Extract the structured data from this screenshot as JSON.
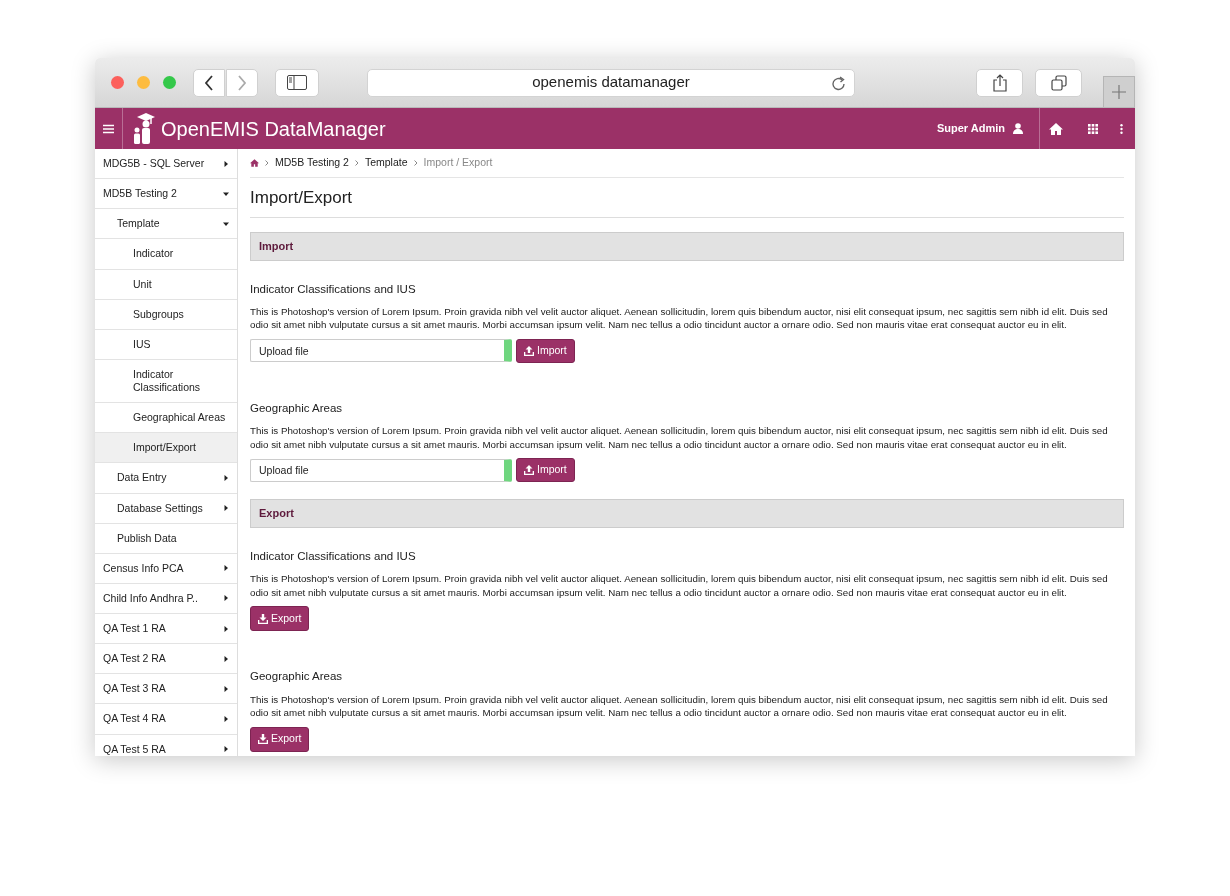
{
  "browser": {
    "address": "openemis datamanager"
  },
  "app": {
    "title": "OpenEMIS DataManager",
    "user": "Super Admin"
  },
  "sidebar": {
    "items": [
      {
        "label": "MDG5B - SQL Server",
        "expanded": false,
        "selected": false
      },
      {
        "label": "MD5B Testing 2",
        "expanded": true,
        "selected": false,
        "children": [
          {
            "label": "Template",
            "expanded": true,
            "selected": false,
            "children": [
              {
                "label": "Indicator",
                "selected": false
              },
              {
                "label": "Unit",
                "selected": false
              },
              {
                "label": "Subgroups",
                "selected": false
              },
              {
                "label": "IUS",
                "selected": false
              },
              {
                "label": "Indicator Classifications",
                "selected": false
              },
              {
                "label": "Geographical Areas",
                "selected": false
              },
              {
                "label": "Import/Export",
                "selected": true
              }
            ]
          },
          {
            "label": "Data Entry",
            "expanded": false,
            "selected": false
          },
          {
            "label": "Database Settings",
            "expanded": false,
            "selected": false
          },
          {
            "label": "Publish Data",
            "selected": false
          }
        ]
      },
      {
        "label": "Census Info PCA",
        "expanded": false,
        "selected": false
      },
      {
        "label": "Child Info Andhra P..",
        "expanded": false,
        "selected": false
      },
      {
        "label": "QA Test 1 RA",
        "expanded": false,
        "selected": false
      },
      {
        "label": "QA Test 2 RA",
        "expanded": false,
        "selected": false
      },
      {
        "label": "QA Test 3 RA",
        "expanded": false,
        "selected": false
      },
      {
        "label": "QA Test 4 RA",
        "expanded": false,
        "selected": false
      },
      {
        "label": "QA Test 5 RA",
        "expanded": false,
        "selected": false
      }
    ]
  },
  "breadcrumb": [
    "MD5B Testing 2",
    "Template",
    "Import / Export"
  ],
  "page_title": "Import/Export",
  "sections": [
    {
      "title": "Import",
      "items": [
        {
          "kind": "upload",
          "title": "Indicator Classifications and IUS",
          "description": "This is Photoshop's version of Lorem Ipsum. Proin gravida nibh vel velit auctor aliquet. Aenean sollicitudin, lorem quis bibendum auctor, nisi elit consequat ipsum, nec sagittis sem nibh id elit. Duis sed odio sit amet nibh vulputate cursus a sit amet mauris. Morbi accumsan ipsum velit. Nam nec tellus a odio tincidunt auctor a ornare odio. Sed non mauris vitae erat consequat auctor eu in elit.",
          "placeholder": "Upload file",
          "button": "Import"
        },
        {
          "kind": "upload",
          "title": "Geographic Areas",
          "description": "This is Photoshop's version of Lorem Ipsum. Proin gravida nibh vel velit auctor aliquet. Aenean sollicitudin, lorem quis bibendum auctor, nisi elit consequat ipsum, nec sagittis sem nibh id elit. Duis sed odio sit amet nibh vulputate cursus a sit amet mauris. Morbi accumsan ipsum velit. Nam nec tellus a odio tincidunt auctor a ornare odio. Sed non mauris vitae erat consequat auctor eu in elit.",
          "placeholder": "Upload file",
          "button": "Import"
        }
      ]
    },
    {
      "title": "Export",
      "items": [
        {
          "kind": "export",
          "title": "Indicator Classifications and IUS",
          "description": "This is Photoshop's version of Lorem Ipsum. Proin gravida nibh vel velit auctor aliquet. Aenean sollicitudin, lorem quis bibendum auctor, nisi elit consequat ipsum, nec sagittis sem nibh id elit. Duis sed odio sit amet nibh vulputate cursus a sit amet mauris. Morbi accumsan ipsum velit. Nam nec tellus a odio tincidunt auctor a ornare odio. Sed non mauris vitae erat consequat auctor eu in elit.",
          "button": "Export"
        },
        {
          "kind": "export",
          "title": "Geographic Areas",
          "description": "This is Photoshop's version of Lorem Ipsum. Proin gravida nibh vel velit auctor aliquet. Aenean sollicitudin, lorem quis bibendum auctor, nisi elit consequat ipsum, nec sagittis sem nibh id elit. Duis sed odio sit amet nibh vulputate cursus a sit amet mauris. Morbi accumsan ipsum velit. Nam nec tellus a odio tincidunt auctor a ornare odio. Sed non mauris vitae erat consequat auctor eu in elit.",
          "button": "Export"
        }
      ]
    }
  ]
}
